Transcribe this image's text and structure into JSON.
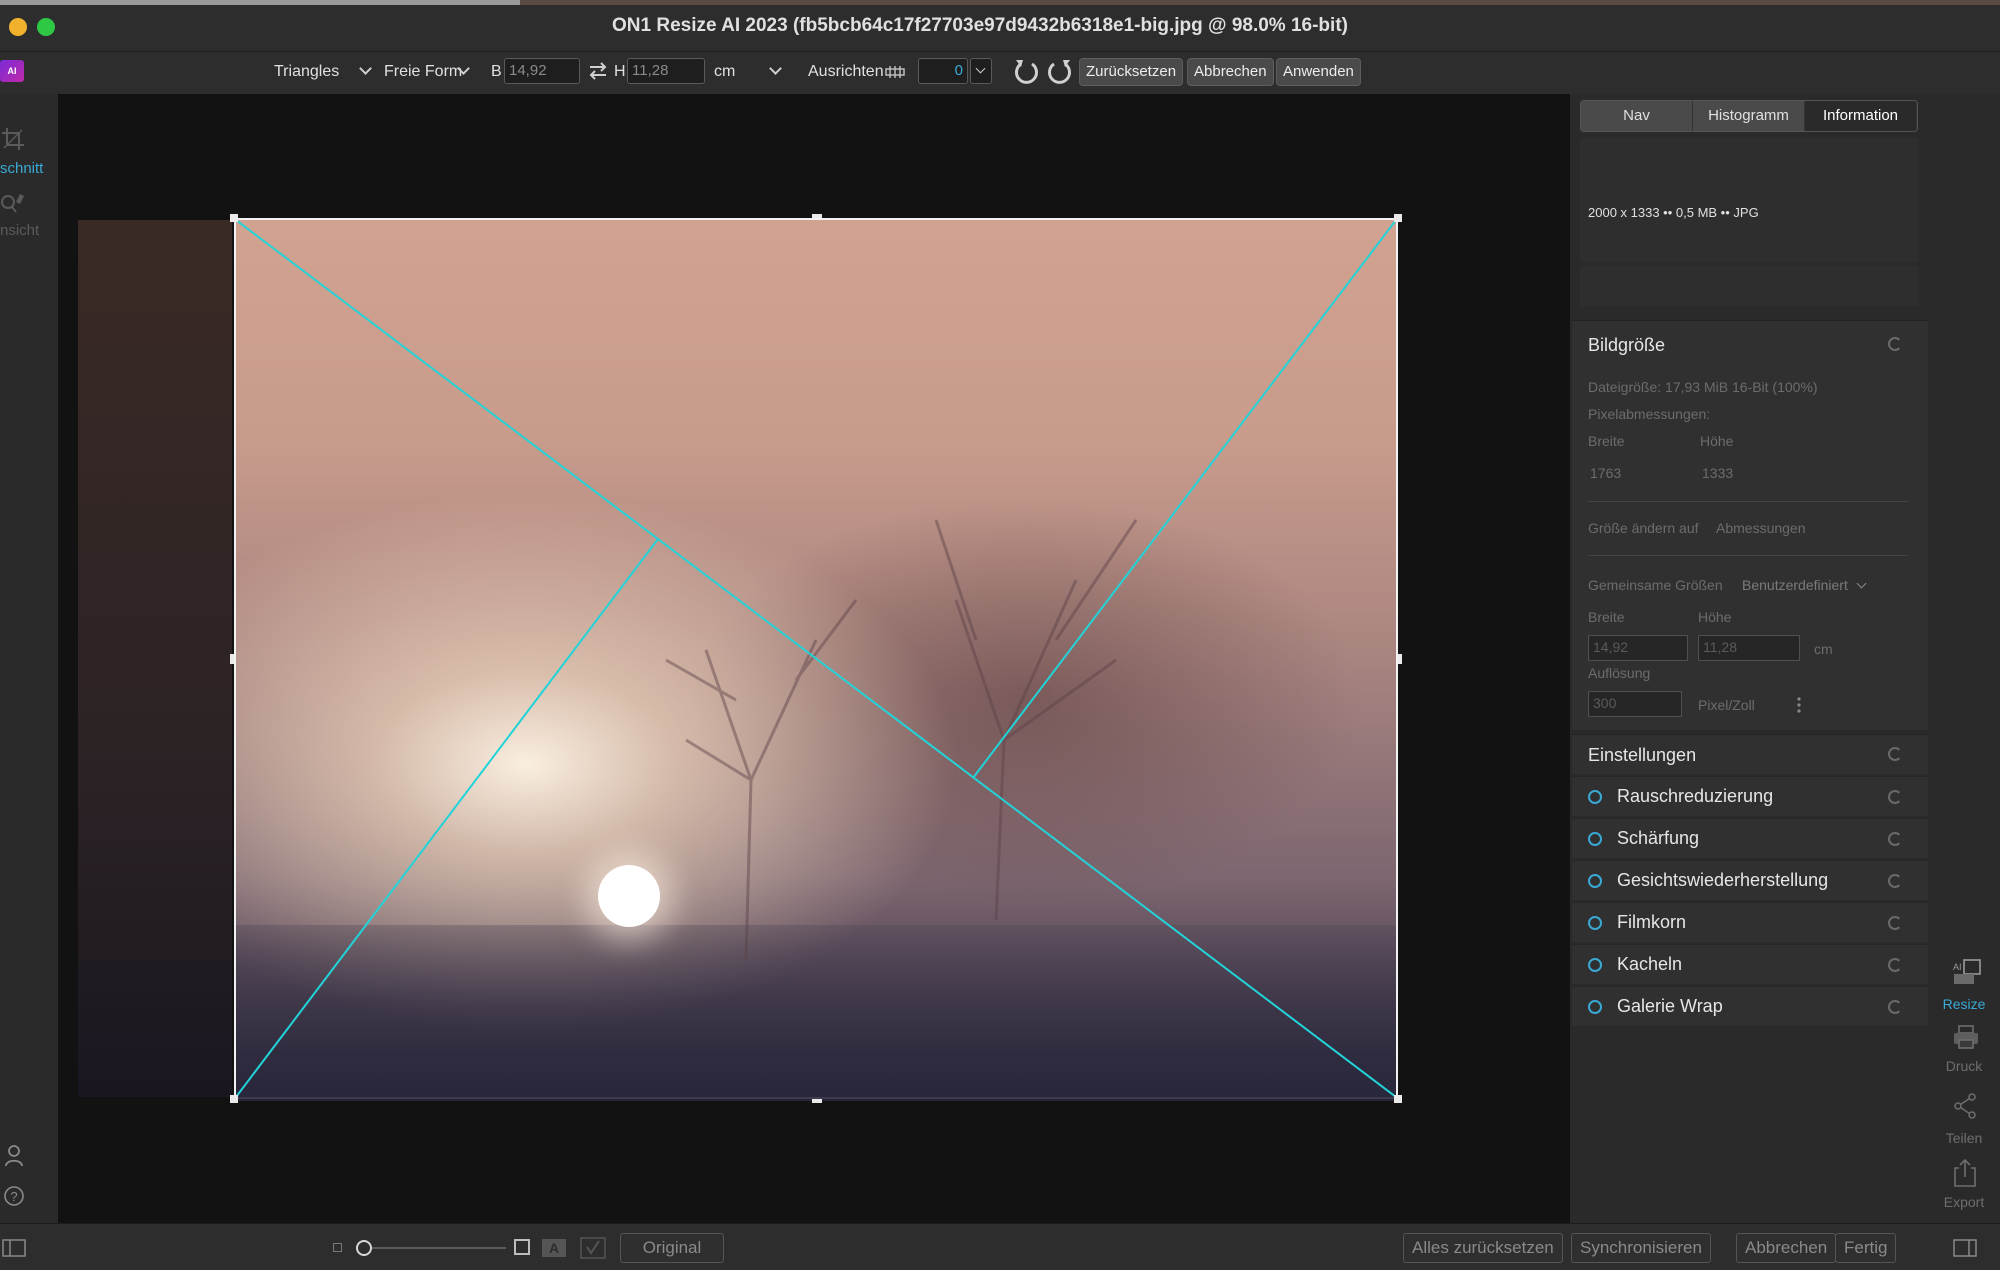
{
  "window": {
    "title": "ON1 Resize AI 2023 (fb5bcb64c17f27703e97d9432b6318e1-big.jpg @ 98.0% 16-bit)"
  },
  "toolbar": {
    "overlay_select": "Triangles",
    "ratio_select": "Freie Form",
    "width_label": "B",
    "width_value": "14,92",
    "height_label": "H",
    "height_value": "11,28",
    "unit_select": "cm",
    "align_label": "Ausrichten",
    "angle_value": "0",
    "reset_label": "Zurücksetzen",
    "cancel_label": "Abbrechen",
    "apply_label": "Anwenden"
  },
  "left_tools": {
    "crop_label": "schnitt",
    "view_label": "nsicht"
  },
  "right_panel": {
    "tabs": [
      {
        "label": "Nav"
      },
      {
        "label": "Histogramm"
      },
      {
        "label": "Information"
      }
    ],
    "info_line": "2000 x 1333 •• 0,5 MB •• JPG",
    "image_size": {
      "title": "Bildgröße",
      "file_size": "Dateigröße: 17,93 MiB 16-Bit (100%)",
      "pixel_dims_label": "Pixelabmessungen:",
      "width_label": "Breite",
      "height_label": "Höhe",
      "pixel_width": "1763",
      "pixel_height": "1333",
      "resize_to_label": "Größe ändern auf",
      "resize_to_value": "Abmessungen",
      "common_sizes_label": "Gemeinsame Größen",
      "common_sizes_value": "Benutzerdefiniert",
      "doc_width_label": "Breite",
      "doc_height_label": "Höhe",
      "doc_width": "14,92",
      "doc_height": "11,28",
      "doc_unit": "cm",
      "resolution_label": "Auflösung",
      "resolution_value": "300",
      "resolution_unit": "Pixel/Zoll"
    },
    "settings": {
      "title": "Einstellungen",
      "items": [
        {
          "label": "Rauschreduzierung"
        },
        {
          "label": "Schärfung"
        },
        {
          "label": "Gesichtswiederherstellung"
        },
        {
          "label": "Filmkorn"
        },
        {
          "label": "Kacheln"
        },
        {
          "label": "Galerie Wrap"
        }
      ]
    }
  },
  "modules": [
    {
      "label": "Resize",
      "icon": "ai-resize-icon",
      "active": true
    },
    {
      "label": "Druck",
      "icon": "printer-icon",
      "active": false
    },
    {
      "label": "Teilen",
      "icon": "share-icon",
      "active": false
    },
    {
      "label": "Export",
      "icon": "export-icon",
      "active": false
    }
  ],
  "bottom": {
    "original_label": "Original",
    "reset_all_label": "Alles zurücksetzen",
    "sync_label": "Synchronisieren",
    "cancel_label": "Abbrechen",
    "done_label": "Fertig"
  },
  "colors": {
    "accent": "#3aa9d6",
    "guide_lines": "#22d3d8"
  }
}
